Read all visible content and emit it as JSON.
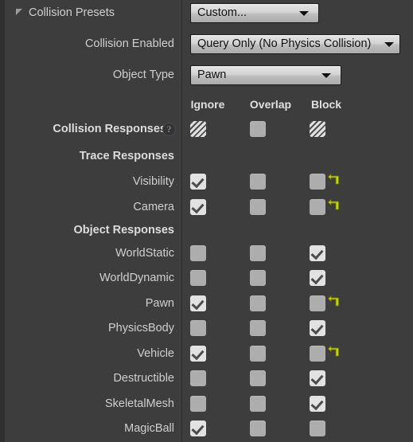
{
  "panel": {
    "section_title": "Collision Presets",
    "expander_icon": "triangle-expanded-icon"
  },
  "fields": [
    {
      "label": "Collision Enabled",
      "value": "Query Only (No Physics Collision)"
    },
    {
      "label": "Object Type",
      "value": "Pawn"
    }
  ],
  "preset": {
    "value": "Custom...",
    "dropdown_icon": "chevron-down-icon"
  },
  "columns": {
    "ignore": "Ignore",
    "overlap": "Overlap",
    "block": "Block"
  },
  "collision_responses": {
    "label": "Collision Responses",
    "help_icon": "help-question-icon",
    "states": {
      "ignore": "mixed",
      "overlap": "unchecked",
      "block": "mixed"
    }
  },
  "groups": [
    {
      "title": "Trace Responses",
      "rows": [
        {
          "label": "Visibility",
          "ignore": "checked",
          "overlap": "unchecked",
          "block": "unchecked",
          "revert": true
        },
        {
          "label": "Camera",
          "ignore": "checked",
          "overlap": "unchecked",
          "block": "unchecked",
          "revert": true
        }
      ]
    },
    {
      "title": "Object Responses",
      "rows": [
        {
          "label": "WorldStatic",
          "ignore": "unchecked",
          "overlap": "unchecked",
          "block": "checked",
          "revert": false
        },
        {
          "label": "WorldDynamic",
          "ignore": "unchecked",
          "overlap": "unchecked",
          "block": "checked",
          "revert": false
        },
        {
          "label": "Pawn",
          "ignore": "checked",
          "overlap": "unchecked",
          "block": "unchecked",
          "revert": true
        },
        {
          "label": "PhysicsBody",
          "ignore": "unchecked",
          "overlap": "unchecked",
          "block": "checked",
          "revert": false
        },
        {
          "label": "Vehicle",
          "ignore": "checked",
          "overlap": "unchecked",
          "block": "unchecked",
          "revert": true
        },
        {
          "label": "Destructible",
          "ignore": "unchecked",
          "overlap": "unchecked",
          "block": "checked",
          "revert": false
        },
        {
          "label": "SkeletalMesh",
          "ignore": "unchecked",
          "overlap": "unchecked",
          "block": "checked",
          "revert": false
        },
        {
          "label": "MagicBall",
          "ignore": "checked",
          "overlap": "unchecked",
          "block": "unchecked",
          "revert": false
        }
      ]
    }
  ],
  "colors": {
    "background": "#3d3d3d",
    "gutter": "#2f2f2f",
    "text": "#cfcfcf",
    "revert_arrow": "#c8d400",
    "checkbox_unchecked": "#adadad",
    "checkbox_checked": "#e2e2e2"
  },
  "revert_icon_name": "revert-arrow-icon"
}
